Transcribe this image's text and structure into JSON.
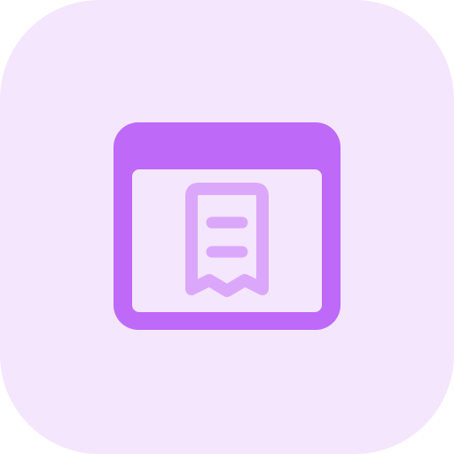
{
  "app_icon": {
    "icon_name": "browser-receipt-icon",
    "colors": {
      "tile_background": "#f4e6fd",
      "window_frame": "#be69f8",
      "window_body": "#f4e6fd",
      "receipt": "#dba7fb"
    }
  }
}
